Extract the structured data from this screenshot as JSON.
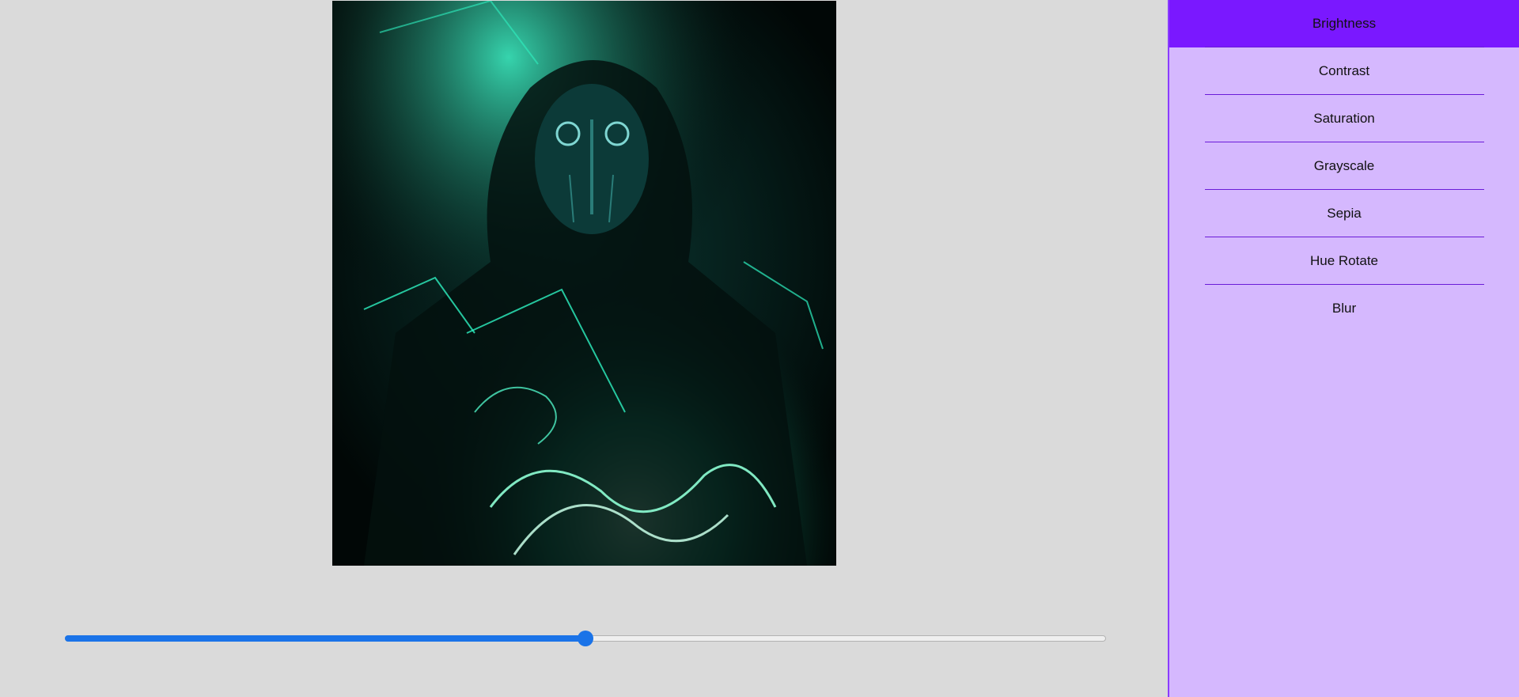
{
  "filters": {
    "items": [
      {
        "label": "Brightness",
        "active": true
      },
      {
        "label": "Contrast",
        "active": false
      },
      {
        "label": "Saturation",
        "active": false
      },
      {
        "label": "Grayscale",
        "active": false
      },
      {
        "label": "Sepia",
        "active": false
      },
      {
        "label": "Hue Rotate",
        "active": false
      },
      {
        "label": "Blur",
        "active": false
      }
    ]
  },
  "slider": {
    "value_fraction": 0.5
  },
  "colors": {
    "accent": "#7a18ff",
    "sidebar_bg": "#d5b8fe",
    "slider": "#1a73e8",
    "glow": "#2ef2c2"
  }
}
